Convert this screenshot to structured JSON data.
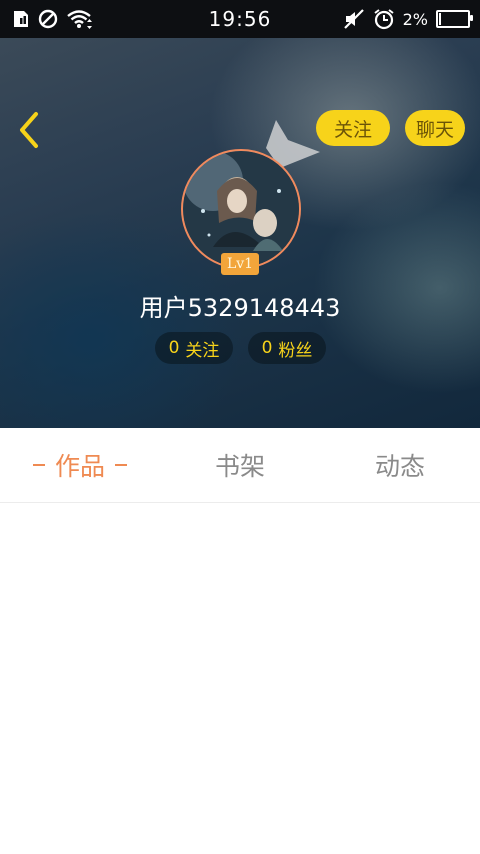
{
  "status_bar": {
    "time": "19:56",
    "battery_text": "2%",
    "battery_level": 0.02,
    "icons": [
      "sim-icon",
      "blocked-icon",
      "wifi-icon",
      "mute-icon",
      "alarm-icon",
      "battery-icon"
    ]
  },
  "header": {
    "follow_button": "关注",
    "chat_button": "聊天",
    "level": "Lv1",
    "username": "用户5329148443",
    "following_count": "0",
    "following_label": "关注",
    "fans_count": "0",
    "fans_label": "粉丝"
  },
  "tabs": [
    {
      "label": "作品",
      "active": true
    },
    {
      "label": "书架",
      "active": false
    },
    {
      "label": "动态",
      "active": false
    }
  ],
  "colors": {
    "accent": "#f7d31a",
    "active_tab": "#ef8a52",
    "avatar_border": "#f08a5d",
    "level_badge": "#f2a53a"
  }
}
